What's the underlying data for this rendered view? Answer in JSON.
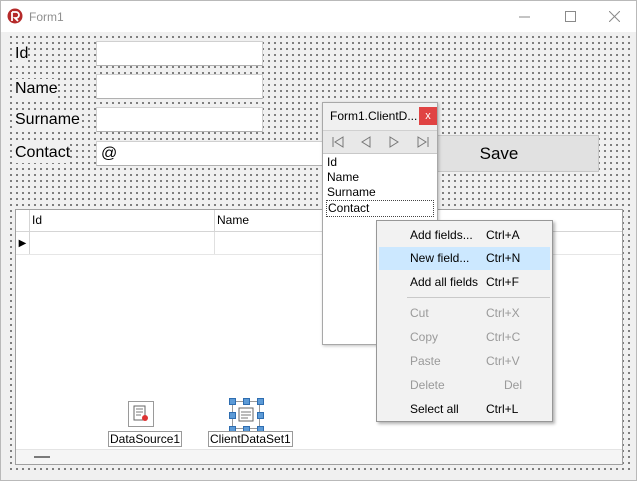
{
  "window": {
    "title": "Form1"
  },
  "form": {
    "labels": {
      "id": "Id",
      "name": "Name",
      "surname": "Surname",
      "contact": "Contact"
    },
    "values": {
      "id": "",
      "name": "",
      "surname": "",
      "contact": "@"
    },
    "save_label": "Save"
  },
  "grid": {
    "columns": [
      "Id",
      "Name"
    ],
    "row_indicator": "▶"
  },
  "components": {
    "datasource": "DataSource1",
    "clientdataset": "ClientDataSet1"
  },
  "fields_editor": {
    "title": "Form1.ClientD...",
    "close": "x",
    "fields": [
      "Id",
      "Name",
      "Surname",
      "Contact"
    ],
    "selected_field": "Contact"
  },
  "context_menu": {
    "items": [
      {
        "label": "Add fields...",
        "shortcut": "Ctrl+A",
        "enabled": true,
        "highlighted": false
      },
      {
        "label": "New field...",
        "shortcut": "Ctrl+N",
        "enabled": true,
        "highlighted": true
      },
      {
        "label": "Add all fields",
        "shortcut": "Ctrl+F",
        "enabled": true,
        "highlighted": false
      },
      {
        "label": "Cut",
        "shortcut": "Ctrl+X",
        "enabled": false,
        "highlighted": false
      },
      {
        "label": "Copy",
        "shortcut": "Ctrl+C",
        "enabled": false,
        "highlighted": false
      },
      {
        "label": "Paste",
        "shortcut": "Ctrl+V",
        "enabled": false,
        "highlighted": false
      },
      {
        "label": "Delete",
        "shortcut": "Del",
        "enabled": false,
        "highlighted": false
      },
      {
        "label": "Select all",
        "shortcut": "Ctrl+L",
        "enabled": true,
        "highlighted": false
      }
    ]
  },
  "colors": {
    "highlight": "#cce8ff",
    "close_red": "#e04343",
    "selection_handle": "#5c9ad6"
  }
}
